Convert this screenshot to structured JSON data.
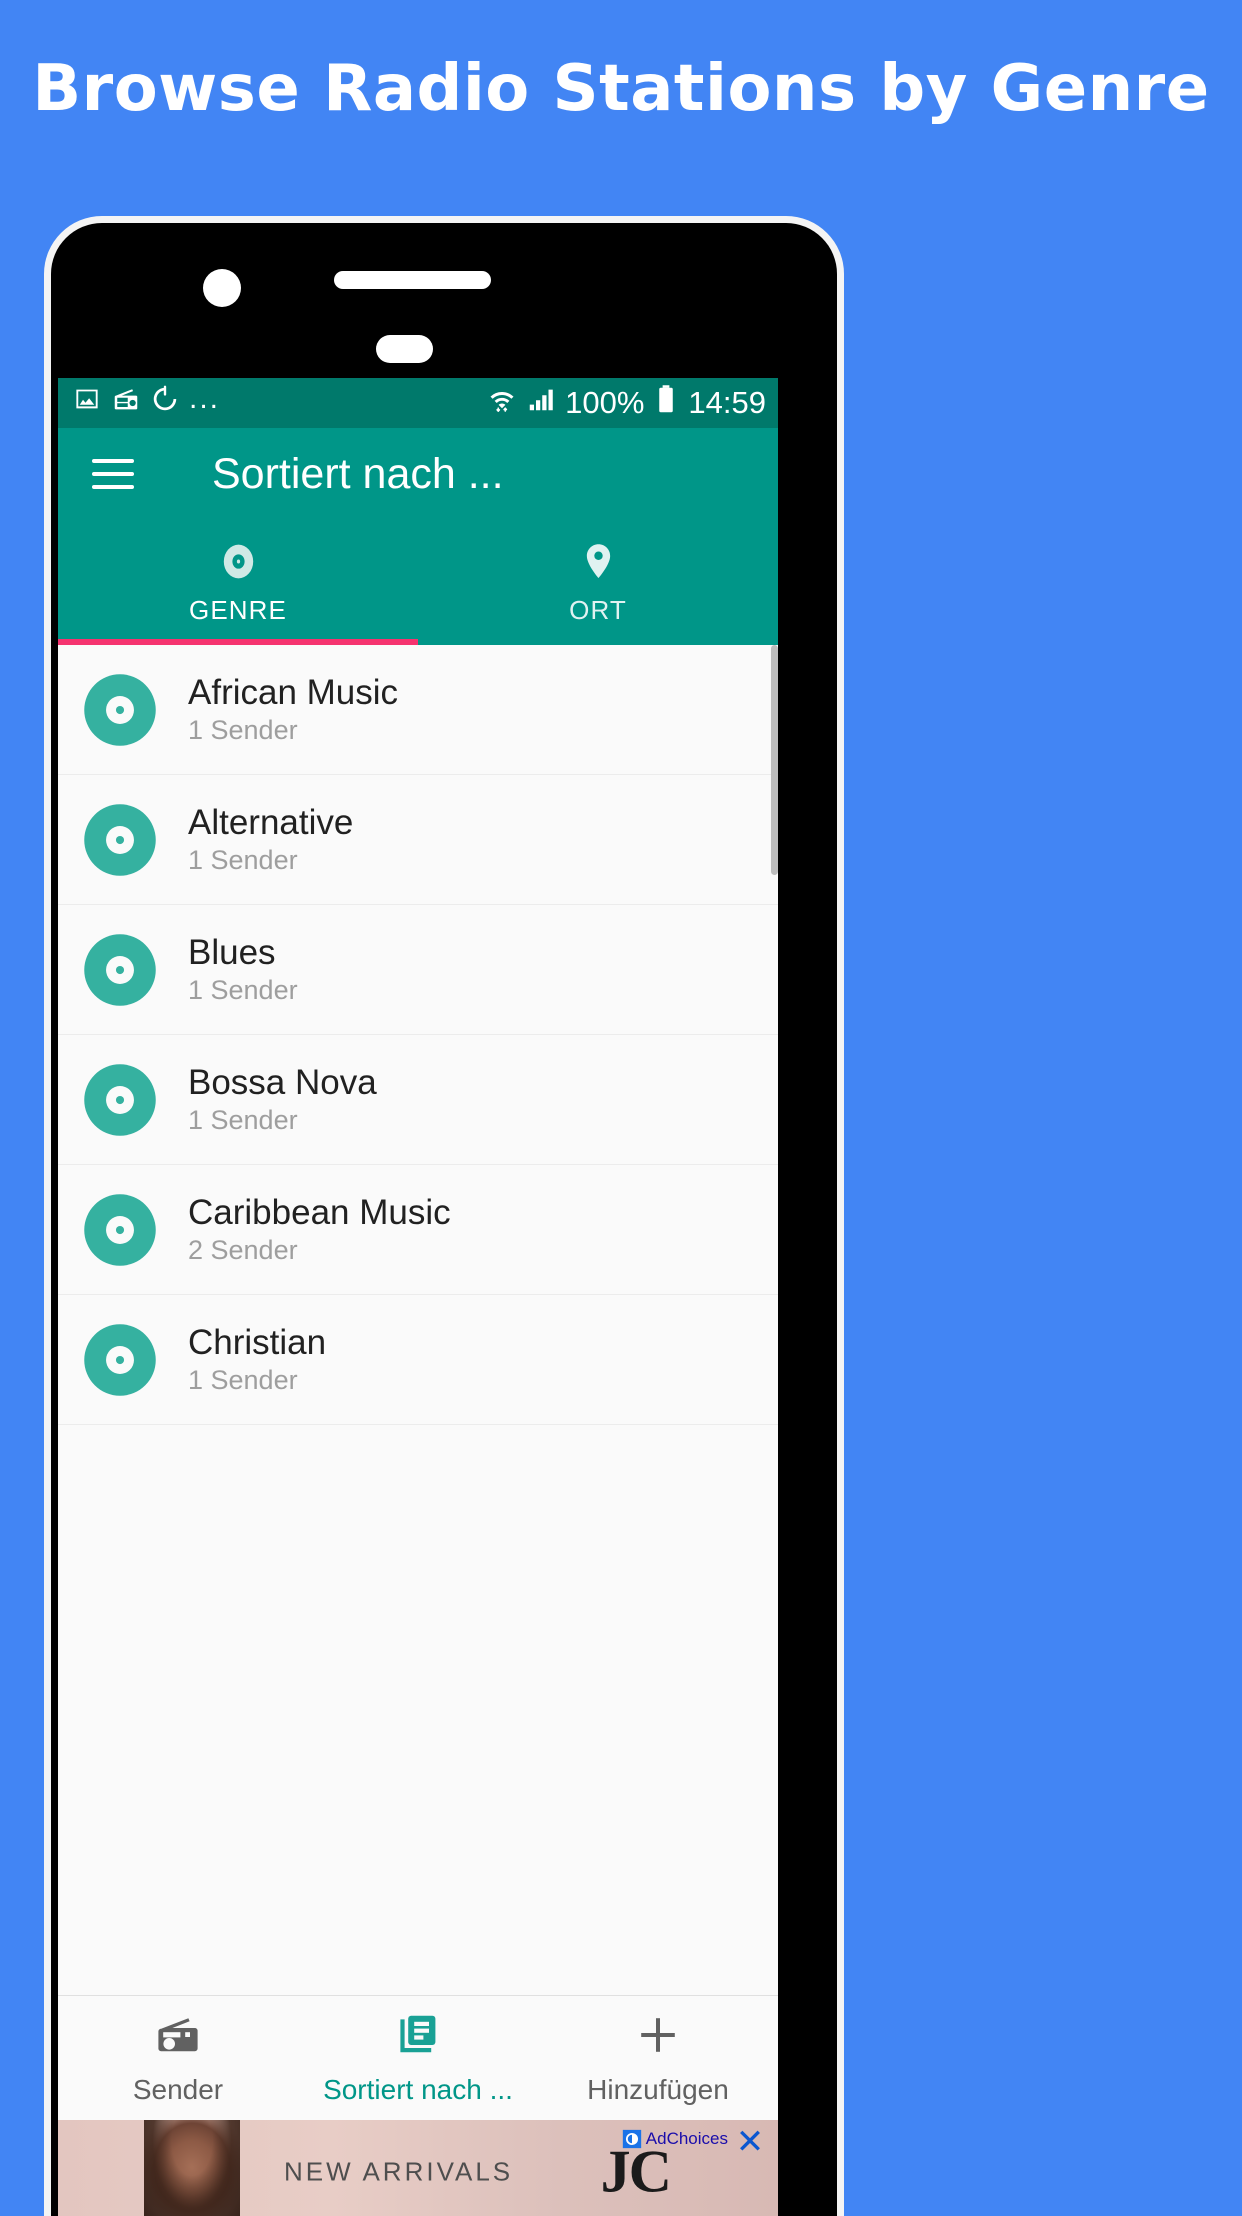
{
  "promo": {
    "headline": "Browse Radio Stations by Genre"
  },
  "statusbar": {
    "left_icons": [
      "image-icon",
      "radio-icon",
      "timer-icon"
    ],
    "overflow": "...",
    "wifi": "wifi-icon",
    "signal": "signal-icon",
    "battery_percent": "100%",
    "battery": "battery-icon",
    "time": "14:59"
  },
  "appbar": {
    "menu_icon": "hamburger-icon",
    "title": "Sortiert nach ..."
  },
  "tabs": [
    {
      "label": "GENRE",
      "icon": "disc-icon",
      "active": true
    },
    {
      "label": "ORT",
      "icon": "location-pin-icon",
      "active": false
    }
  ],
  "list": {
    "items": [
      {
        "title": "African Music",
        "subtitle": "1 Sender"
      },
      {
        "title": "Alternative",
        "subtitle": "1 Sender"
      },
      {
        "title": "Blues",
        "subtitle": "1 Sender"
      },
      {
        "title": "Bossa Nova",
        "subtitle": "1 Sender"
      },
      {
        "title": "Caribbean Music",
        "subtitle": "2 Sender"
      },
      {
        "title": "Christian",
        "subtitle": "1 Sender"
      }
    ]
  },
  "bottomnav": [
    {
      "label": "Sender",
      "icon": "radio-icon",
      "active": false
    },
    {
      "label": "Sortiert nach ...",
      "icon": "list-icon",
      "active": true
    },
    {
      "label": "Hinzufügen",
      "icon": "plus-icon",
      "active": false
    }
  ],
  "ad": {
    "headline": "NEW ARRIVALS",
    "brand": "JC",
    "adchoices": "AdChoices",
    "close": "✕"
  },
  "colors": {
    "background": "#4285f4",
    "statusbar": "#00796b",
    "primary": "#009688",
    "accent": "#f5336f",
    "disc": "#35b1a0",
    "text_primary": "#212121",
    "text_secondary": "#9e9e9e"
  }
}
